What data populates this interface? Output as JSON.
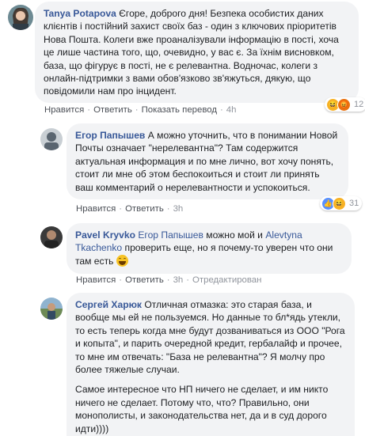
{
  "comments": [
    {
      "author": "Tanya Potapova",
      "text": "Єгоре, доброго дня! Безпека особистих даних клієнтів і постійний захист своїх баз - один з ключових пріоритетів Нова Пошта. Колеги вже проаналізували інформацію в пості, хоча це лише частина того, що, очевидно, у вас є. За їхнім висновком, база, що фігурує в пості, не є релевантна. Водночас, колеги з онлайн-підтримки з вами обов'язково зв'яжуться, дякую, що повідомили нам про інцидент.",
      "actions": [
        "Нравится",
        "Ответить",
        "Показать перевод"
      ],
      "time": "4h",
      "reaction_count": "12",
      "reactions": [
        "haha-icon",
        "angry-icon"
      ]
    },
    {
      "author": "Егор Папышев",
      "text": "А можно уточнить, что в понимании Новой Почты означает \"нерелевантна\"? Там содержится актуальная информация и по мне лично, вот хочу понять, стоит ли мне об этом беспокоиться и стоит ли принять ваш комментарий о нерелевантности и успокоиться.",
      "actions": [
        "Нравится",
        "Ответить"
      ],
      "time": "3h",
      "reaction_count": "31",
      "reactions": [
        "like-icon",
        "haha-icon"
      ]
    },
    {
      "author": "Pavel Kryvko",
      "mention1": "Егор Папышев",
      "text_mid": " можно мой и ",
      "mention2": "Alevtyna Tkachenko",
      "text_end": " проверить еще, но я почему-то уверен что они там есть",
      "actions": [
        "Нравится",
        "Ответить"
      ],
      "time": "3h",
      "status": "Отредактирован"
    },
    {
      "author": "Сергей Харюк",
      "text": "Отличная отмазка: это старая база, и вообще мы ей не пользуемся. Но данные то бл*ядь утекли, то есть теперь когда мне будут дозваниваться из ООО \"Рога и копыта\", и парить очередной кредит, гербалайф и прочее, то мне им отвечать: \"База не релевантна\"? Я молчу про более тяжелые случаи.",
      "text2": "Самое интересное что НП ничего не сделает, и им никто ничего не сделает. Потому что, что? Правильно, они монополисты, и законодательства нет, да и в суд дорого идти))))"
    }
  ],
  "colors": {
    "link": "#385898",
    "bubble": "#f2f3f5",
    "meta": "#90949c"
  }
}
